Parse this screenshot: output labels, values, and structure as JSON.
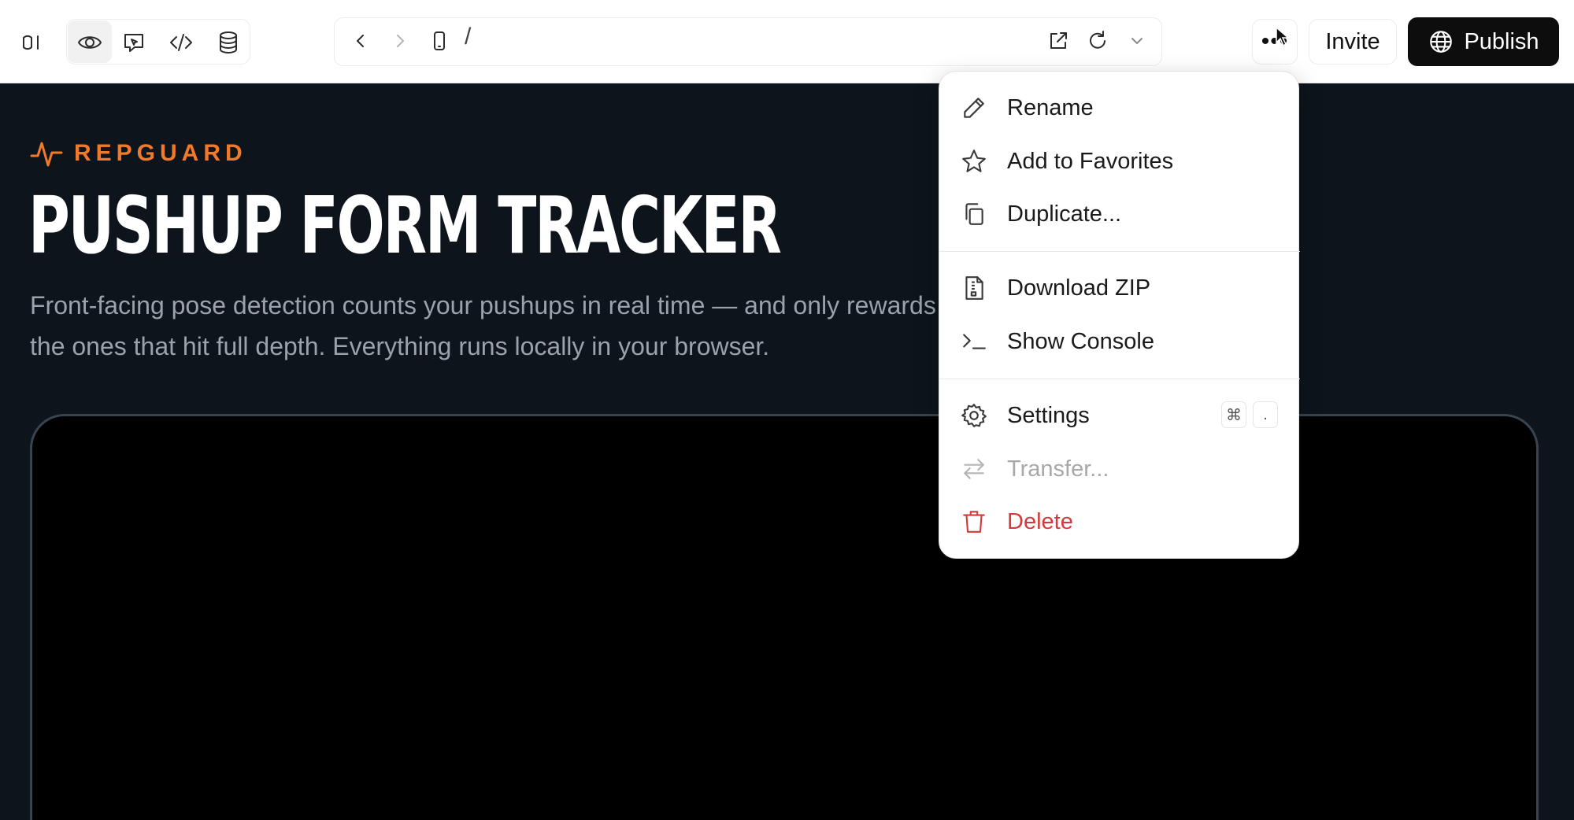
{
  "toolbar": {
    "sidebar_toggle_icon": "sidebar-toggle-icon",
    "view_icons": [
      "eye-icon",
      "cursor-chat-icon",
      "code-icon",
      "database-icon"
    ],
    "nav_icons": [
      "chevron-left-icon",
      "chevron-right-icon",
      "phone-icon"
    ],
    "url_path": "/",
    "url_action_icons": [
      "external-link-icon",
      "refresh-icon",
      "chevron-down-icon"
    ],
    "more_label": "•••",
    "invite_label": "Invite",
    "publish_label": "Publish"
  },
  "preview": {
    "brand_name": "REPGUARD",
    "headline": "PUSHUP FORM TRACKER",
    "subtitle": "Front-facing pose detection counts your pushups in real time — and only rewards the ones that hit full depth. Everything runs locally in your browser."
  },
  "menu": {
    "items": [
      {
        "label": "Rename",
        "icon": "pencil-icon"
      },
      {
        "label": "Add to Favorites",
        "icon": "star-icon"
      },
      {
        "label": "Duplicate...",
        "icon": "copy-icon"
      },
      {
        "label": "Download ZIP",
        "icon": "file-zip-icon"
      },
      {
        "label": "Show Console",
        "icon": "terminal-icon"
      },
      {
        "label": "Settings",
        "icon": "gear-icon",
        "shortcut": [
          "⌘",
          "."
        ]
      },
      {
        "label": "Transfer...",
        "icon": "transfer-icon",
        "disabled": true
      },
      {
        "label": "Delete",
        "icon": "trash-icon",
        "danger": true
      }
    ]
  },
  "colors": {
    "brand_accent": "#f07a2a",
    "preview_bg": "#0d141b",
    "danger": "#d33a3a",
    "publish_bg": "#0d0d0d"
  }
}
